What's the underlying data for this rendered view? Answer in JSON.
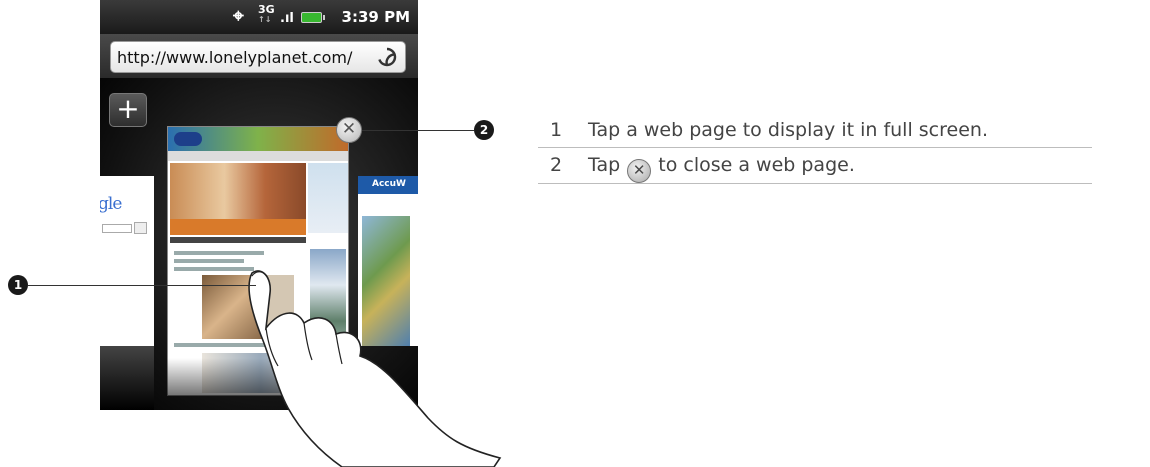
{
  "status_bar": {
    "gps_icon": "gps-icon",
    "network_label": "3G",
    "signal_icon": "signal-bars-icon",
    "battery_icon": "battery-icon",
    "time": "3:39 PM"
  },
  "browser": {
    "url": "http://www.lonelyplanet.com/",
    "refresh_icon": "refresh-icon",
    "new_tab_label": "+",
    "close_icon": "close-icon",
    "tabs": [
      {
        "site": "google",
        "label": "gle"
      },
      {
        "site": "lonelyplanet",
        "label": ""
      },
      {
        "site": "accuweather",
        "label": "AccuW"
      }
    ]
  },
  "callouts": [
    "1",
    "2"
  ],
  "steps": [
    {
      "num": "1",
      "text": "Tap a web page to display it in full screen."
    },
    {
      "num": "2",
      "text_before": "Tap",
      "icon": "close-icon",
      "text_after": "to close a web page."
    }
  ],
  "colors": {
    "badge": "#1a1a1a",
    "divider": "#bdbdbd",
    "text": "#444444"
  }
}
